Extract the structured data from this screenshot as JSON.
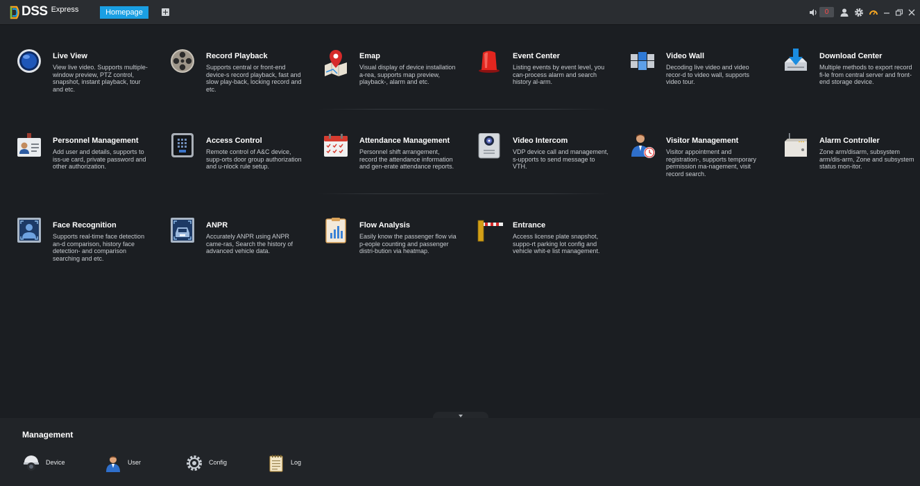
{
  "header": {
    "logo_text": "DSS",
    "logo_sub": "Express",
    "tab_home": "Homepage",
    "alarm_count": "0",
    "icons": [
      "volume-icon",
      "user-icon",
      "gear-icon",
      "performance-icon",
      "minimize-icon",
      "restore-icon",
      "close-icon"
    ],
    "accent": "#1a9fe3",
    "alarm_color": "#ff4a4a"
  },
  "apps": [
    {
      "title": "Live View",
      "desc": "View live video. Supports multiple-window preview, PTZ control, snapshot, instant playback, tour and etc.",
      "icon": "live-view-icon"
    },
    {
      "title": "Record Playback",
      "desc": "Supports central or front-end device-s record playback, fast and slow play-back, locking record and etc.",
      "icon": "film-reel-icon"
    },
    {
      "title": "Emap",
      "desc": "Visual display of device installation a-rea, supports map preview, playback-, alarm and etc.",
      "icon": "map-pin-icon"
    },
    {
      "title": "Event Center",
      "desc": "Listing events by event level, you can-process alarm and search history al-arm.",
      "icon": "alarm-light-icon"
    },
    {
      "title": "Video Wall",
      "desc": "Decoding live video and video recor-d to video wall, supports video tour.",
      "icon": "video-wall-icon"
    },
    {
      "title": "Download Center",
      "desc": "Multiple methods to export record fi-le from central server and front-end storage device.",
      "icon": "download-icon"
    },
    {
      "title": "Personnel Management",
      "desc": "Add user and details, supports to iss-ue card, private password and other authorization.",
      "icon": "id-card-icon"
    },
    {
      "title": "Access Control",
      "desc": "Remote control of A&C device, supp-orts door group authorization and u-nlock rule setup.",
      "icon": "access-panel-icon"
    },
    {
      "title": "Attendance Management",
      "desc": "Personnel shift arrangement, record the attendance information and gen-erate attendance reports.",
      "icon": "calendar-icon"
    },
    {
      "title": "Video Intercom",
      "desc": "VDP device call and management, s-upports to send message to VTH.",
      "icon": "intercom-icon"
    },
    {
      "title": "Visitor Management",
      "desc": "Visitor appointment and registration-, supports temporary permission ma-nagement, visit record search.",
      "icon": "visitor-icon"
    },
    {
      "title": "Alarm Controller",
      "desc": "Zone arm/disarm, subsystem arm/dis-arm, Zone and subsystem status mon-itor.",
      "icon": "alarm-controller-icon"
    },
    {
      "title": "Face Recognition",
      "desc": "Supports real-time face detection an-d comparison, history face detection- and comparison searching and etc.",
      "icon": "face-scan-icon"
    },
    {
      "title": "ANPR",
      "desc": "Accurately ANPR using ANPR came-ras, Search the history of advanced vehicle data.",
      "icon": "car-scan-icon"
    },
    {
      "title": "Flow Analysis",
      "desc": "Easily know the passenger flow via p-eople counting and passenger distri-bution via heatmap.",
      "icon": "clipboard-chart-icon"
    },
    {
      "title": "Entrance",
      "desc": "Access license plate snapshot, suppo-rt parking lot config and vehicle whit-e list management.",
      "icon": "barrier-gate-icon"
    }
  ],
  "management": {
    "title": "Management",
    "items": [
      {
        "label": "Device",
        "icon": "camera-dome-icon"
      },
      {
        "label": "User",
        "icon": "user-avatar-icon"
      },
      {
        "label": "Config",
        "icon": "config-gear-icon"
      },
      {
        "label": "Log",
        "icon": "log-notepad-icon"
      }
    ]
  }
}
